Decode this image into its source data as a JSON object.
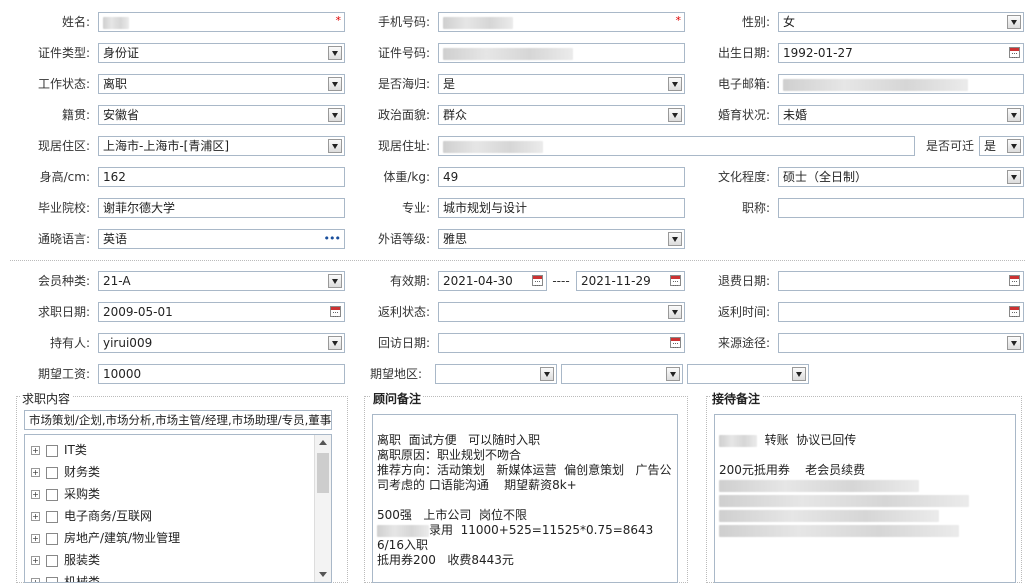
{
  "form": {
    "name_label": "姓名:",
    "phone_label": "手机号码:",
    "gender_label": "性别:",
    "gender_value": "女",
    "idtype_label": "证件类型:",
    "idtype_value": "身份证",
    "idno_label": "证件号码:",
    "birth_label": "出生日期:",
    "birth_value": "1992-01-27",
    "workstatus_label": "工作状态:",
    "workstatus_value": "离职",
    "overseas_label": "是否海归:",
    "overseas_value": "是",
    "email_label": "电子邮箱:",
    "native_label": "籍贯:",
    "native_value": "安徽省",
    "political_label": "政治面貌:",
    "political_value": "群众",
    "marital_label": "婚育状况:",
    "marital_value": "未婚",
    "residence_label": "现居住区:",
    "residence_value": "上海市-上海市-[青浦区]",
    "address_label": "现居住址:",
    "relocate_label": "是否可迁",
    "relocate_value": "是",
    "height_label": "身高/cm:",
    "height_value": "162",
    "weight_label": "体重/kg:",
    "weight_value": "49",
    "education_label": "文化程度:",
    "education_value": "硕士（全日制）",
    "school_label": "毕业院校:",
    "school_value": "谢菲尔德大学",
    "major_label": "专业:",
    "major_value": "城市规划与设计",
    "title_label": "职称:",
    "language_label": "通晓语言:",
    "language_value": "英语",
    "language_more": "•••",
    "foreign_level_label": "外语等级:",
    "foreign_level_value": "雅思"
  },
  "member": {
    "type_label": "会员种类:",
    "type_value": "21-A",
    "valid_label": "有效期:",
    "valid_from": "2021-04-30",
    "valid_sep": "----",
    "valid_to": "2021-11-29",
    "refund_date_label": "退费日期:",
    "jobseek_date_label": "求职日期:",
    "jobseek_date_value": "2009-05-01",
    "rebate_status_label": "返利状态:",
    "rebate_time_label": "返利时间:",
    "holder_label": "持有人:",
    "holder_value": "yirui009",
    "visit_date_label": "回访日期:",
    "source_label": "来源途径:",
    "salary_label": "期望工资:",
    "salary_value": "10000",
    "area_label": "期望地区:"
  },
  "jobs": {
    "title": "求职内容",
    "summary": "市场策划/企划,市场分析,市场主管/经理,市场助理/专员,董事",
    "categories": [
      "IT类",
      "财务类",
      "采购类",
      "电子商务/互联网",
      "房地产/建筑/物业管理",
      "服装类",
      "机械类"
    ],
    "expand_glyph": "+"
  },
  "advisor": {
    "title": "顾问备注",
    "lines": [
      "离职  面试方便   可以随时入职",
      "离职原因：职业规划不吻合",
      "推荐方向：活动策划   新媒体运营  偏创意策划   广告公",
      "司考虑的 口语能沟通    期望薪资8k+",
      "",
      "500强   上市公司  岗位不限",
      "录用  11000+525=11525*0.75=8643   6/16入职",
      "抵用券200   收费8443元"
    ]
  },
  "reception": {
    "title": "接待备注",
    "line1": "转账  协议已回传",
    "line2": "200元抵用券    老会员续费"
  },
  "colors": {
    "border": "#a9b8c8",
    "required": "#dd0000"
  }
}
